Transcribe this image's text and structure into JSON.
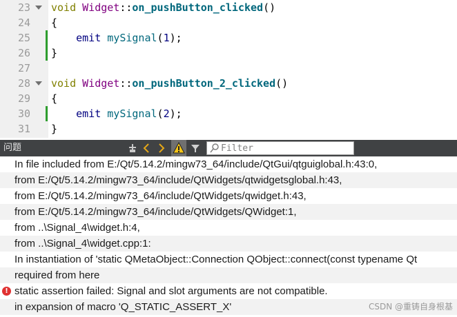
{
  "editor": {
    "lines": [
      {
        "num": "23",
        "has_fold": true,
        "changed": false,
        "tokens": [
          {
            "t": "void",
            "c": "tok-kw"
          },
          {
            "t": " ",
            "c": ""
          },
          {
            "t": "Widget",
            "c": "tok-cls"
          },
          {
            "t": "::",
            "c": ""
          },
          {
            "t": "on_pushButton_clicked",
            "c": "tok-fn"
          },
          {
            "t": "()",
            "c": ""
          }
        ]
      },
      {
        "num": "24",
        "has_fold": false,
        "changed": false,
        "tokens": [
          {
            "t": "{",
            "c": ""
          }
        ]
      },
      {
        "num": "25",
        "has_fold": false,
        "changed": true,
        "tokens": [
          {
            "t": "    ",
            "c": ""
          },
          {
            "t": "emit",
            "c": "tok-emit"
          },
          {
            "t": " ",
            "c": ""
          },
          {
            "t": "mySignal",
            "c": "tok-sig"
          },
          {
            "t": "(",
            "c": ""
          },
          {
            "t": "1",
            "c": "tok-num"
          },
          {
            "t": ");",
            "c": ""
          }
        ]
      },
      {
        "num": "26",
        "has_fold": false,
        "changed": true,
        "tokens": [
          {
            "t": "}",
            "c": ""
          }
        ]
      },
      {
        "num": "27",
        "has_fold": false,
        "changed": false,
        "tokens": []
      },
      {
        "num": "28",
        "has_fold": true,
        "changed": false,
        "tokens": [
          {
            "t": "void",
            "c": "tok-kw"
          },
          {
            "t": " ",
            "c": ""
          },
          {
            "t": "Widget",
            "c": "tok-cls"
          },
          {
            "t": "::",
            "c": ""
          },
          {
            "t": "on_pushButton_2_clicked",
            "c": "tok-fn"
          },
          {
            "t": "()",
            "c": ""
          }
        ]
      },
      {
        "num": "29",
        "has_fold": false,
        "changed": false,
        "tokens": [
          {
            "t": "{",
            "c": ""
          }
        ]
      },
      {
        "num": "30",
        "has_fold": false,
        "changed": true,
        "tokens": [
          {
            "t": "    ",
            "c": ""
          },
          {
            "t": "emit",
            "c": "tok-emit"
          },
          {
            "t": " ",
            "c": ""
          },
          {
            "t": "mySignal",
            "c": "tok-sig"
          },
          {
            "t": "(",
            "c": ""
          },
          {
            "t": "2",
            "c": "tok-num"
          },
          {
            "t": ");",
            "c": ""
          }
        ]
      },
      {
        "num": "31",
        "has_fold": false,
        "changed": false,
        "tokens": [
          {
            "t": "}",
            "c": ""
          }
        ]
      }
    ]
  },
  "issues_panel": {
    "title": "问题",
    "filter_placeholder": "Filter",
    "icons": [
      "build-steps-icon",
      "prev-arrow-icon",
      "next-arrow-icon",
      "warning-icon",
      "filter-icon"
    ],
    "rows": [
      {
        "text": "In file included from E:/Qt/5.14.2/mingw73_64/include/QtGui/qtguiglobal.h:43:0,",
        "error": false
      },
      {
        "text": "from E:/Qt/5.14.2/mingw73_64/include/QtWidgets/qtwidgetsglobal.h:43,",
        "error": false
      },
      {
        "text": "from E:/Qt/5.14.2/mingw73_64/include/QtWidgets/qwidget.h:43,",
        "error": false
      },
      {
        "text": "from E:/Qt/5.14.2/mingw73_64/include/QtWidgets/QWidget:1,",
        "error": false
      },
      {
        "text": "from ..\\Signal_4\\widget.h:4,",
        "error": false
      },
      {
        "text": "from ..\\Signal_4\\widget.cpp:1:",
        "error": false
      },
      {
        "text": "In instantiation of 'static QMetaObject::Connection QObject::connect(const typename Qt",
        "error": false
      },
      {
        "text": "required from here",
        "error": false
      },
      {
        "text": "static assertion failed: Signal and slot arguments are not compatible.",
        "error": true
      },
      {
        "text": "in expansion of macro 'Q_STATIC_ASSERT_X'",
        "error": false
      }
    ],
    "watermark": "CSDN @重铸自身根基"
  }
}
